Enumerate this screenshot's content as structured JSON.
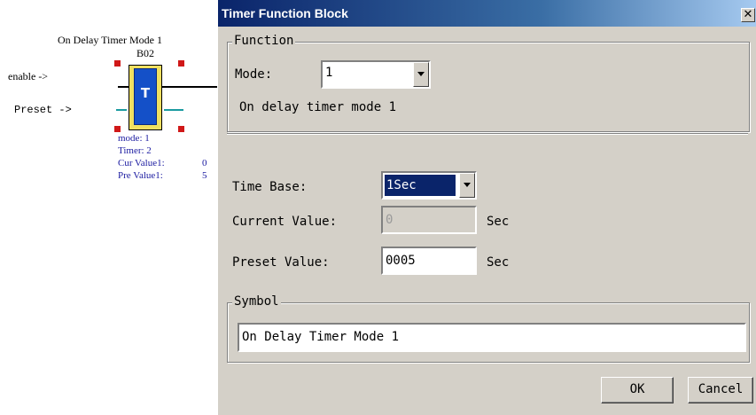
{
  "diagram": {
    "block_title": "On Delay Timer Mode 1",
    "block_id": "B02",
    "block_letter": "T",
    "inputs": {
      "enable": "enable ->",
      "preset": "Preset ->"
    },
    "info": {
      "mode": "mode: 1",
      "timer": "Timer: 2",
      "cur_label": "Cur Value1:",
      "cur_value": "0",
      "pre_label": "Pre Value1:",
      "pre_value": "5"
    }
  },
  "dialog": {
    "title": "Timer Function Block",
    "close_glyph": "✕",
    "function_group": {
      "legend": "Function",
      "mode_label": "Mode:",
      "mode_value": "1",
      "description": "On delay timer mode 1"
    },
    "time_base": {
      "label": "Time Base:",
      "value": "1Sec"
    },
    "current_value": {
      "label": "Current Value:",
      "value": "0",
      "unit": "Sec"
    },
    "preset_value": {
      "label": "Preset Value:",
      "value": "0005",
      "unit": "Sec"
    },
    "symbol_group": {
      "legend": "Symbol",
      "value": "On Delay Timer Mode 1"
    },
    "buttons": {
      "ok": "OK",
      "cancel": "Cancel"
    }
  }
}
